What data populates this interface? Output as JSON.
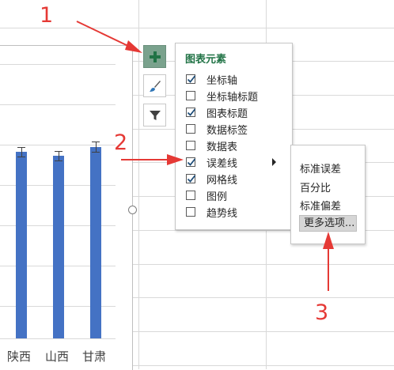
{
  "chart": {
    "categories": [
      "陕西",
      "山西",
      "甘肃"
    ],
    "bar_color": "#4472c4"
  },
  "side_buttons": [
    {
      "name": "chart-elements-button",
      "icon": "plus-icon"
    },
    {
      "name": "chart-styles-button",
      "icon": "paintbrush-icon"
    },
    {
      "name": "chart-filters-button",
      "icon": "funnel-icon"
    }
  ],
  "elements_panel": {
    "title": "图表元素",
    "items": [
      {
        "label": "坐标轴",
        "checked": true
      },
      {
        "label": "坐标轴标题",
        "checked": false
      },
      {
        "label": "图表标题",
        "checked": true
      },
      {
        "label": "数据标签",
        "checked": false
      },
      {
        "label": "数据表",
        "checked": false
      },
      {
        "label": "误差线",
        "checked": true,
        "has_submenu": true
      },
      {
        "label": "网格线",
        "checked": true
      },
      {
        "label": "图例",
        "checked": false
      },
      {
        "label": "趋势线",
        "checked": false
      }
    ]
  },
  "error_bars_submenu": {
    "items": [
      "标准误差",
      "百分比",
      "标准偏差",
      "更多选项..."
    ],
    "highlighted": "更多选项..."
  },
  "annotations": {
    "step1": "1",
    "step2": "2",
    "step3": "3",
    "color": "#e53935"
  },
  "accent_color": "#217346"
}
